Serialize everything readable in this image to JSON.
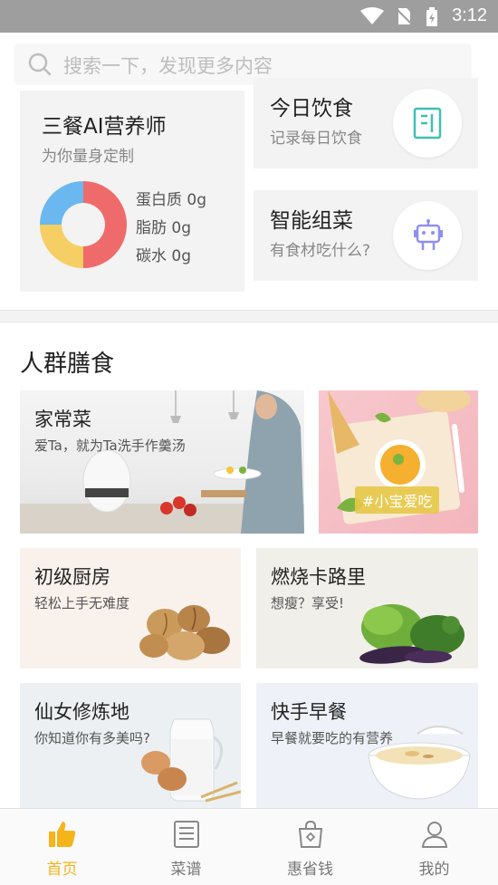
{
  "status_bar": {
    "time": "3:12"
  },
  "search": {
    "placeholder": "搜索一下，发现更多内容"
  },
  "ai_card": {
    "title": "三餐AI营养师",
    "subtitle": "为你量身定制",
    "nutrients": [
      {
        "label": "蛋白质 0g"
      },
      {
        "label": "脂肪 0g"
      },
      {
        "label": "碳水 0g"
      }
    ],
    "donut_colors": [
      "#ef6b6b",
      "#f5cf63",
      "#6ab8ef"
    ]
  },
  "diet_card": {
    "title": "今日饮食",
    "subtitle": "记录每日饮食",
    "icon": "notebook-icon",
    "icon_color": "#3fc0b0"
  },
  "combo_card": {
    "title": "智能组菜",
    "subtitle": "有食材吃什么?",
    "icon": "robot-icon",
    "icon_color": "#8f8ff0"
  },
  "section": {
    "title": "人群膳食"
  },
  "tiles": {
    "home": {
      "title": "家常菜",
      "subtitle": "爱Ta，就为Ta洗手作羹汤"
    },
    "baby": {
      "tag": "#小宝爱吃"
    },
    "beginner": {
      "title": "初级厨房",
      "subtitle": "轻松上手无难度"
    },
    "calorie": {
      "title": "燃烧卡路里",
      "subtitle": "想瘦？享受!"
    },
    "fairy": {
      "title": "仙女修炼地",
      "subtitle": "你知道你有多美吗?"
    },
    "breakfast": {
      "title": "快手早餐",
      "subtitle": "早餐就要吃的有营养"
    }
  },
  "tabs": [
    {
      "label": "首页",
      "icon": "thumbs-up-icon",
      "active": true
    },
    {
      "label": "菜谱",
      "icon": "recipe-book-icon",
      "active": false
    },
    {
      "label": "惠省钱",
      "icon": "shopping-bag-icon",
      "active": false
    },
    {
      "label": "我的",
      "icon": "user-icon",
      "active": false
    }
  ],
  "colors": {
    "accent": "#f4b41a"
  }
}
